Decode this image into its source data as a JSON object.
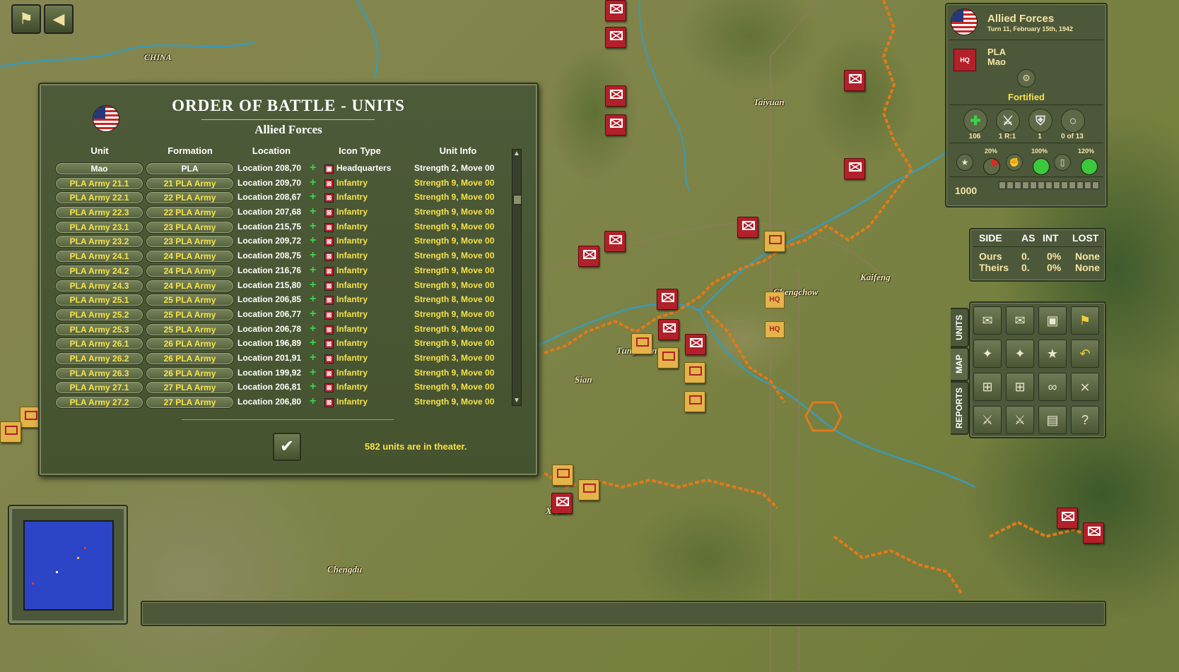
{
  "map": {
    "labels": [
      "CHINA",
      "Taiyuan",
      "Chengchow",
      "Kaifeng",
      "Tungkwan",
      "Sian",
      "Xi'an",
      "Chengdu"
    ]
  },
  "toolbar": {
    "flag_icon": "flag-icon",
    "back_icon": "back-arrow-icon"
  },
  "oob": {
    "title": "ORDER OF BATTLE - UNITS",
    "subtitle": "Allied Forces",
    "columns": [
      "Unit",
      "Formation",
      "Location",
      "Icon Type",
      "Unit Info"
    ],
    "rows": [
      {
        "unit": "Mao",
        "formation": "PLA",
        "location": "Location 208,70",
        "type": "Headquarters",
        "info": "Strength 2, Move 00"
      },
      {
        "unit": "PLA Army 21.1",
        "formation": "21 PLA Army",
        "location": "Location 209,70",
        "type": "Infantry",
        "info": "Strength 9, Move 00"
      },
      {
        "unit": "PLA Army 22.1",
        "formation": "22 PLA Army",
        "location": "Location 208,67",
        "type": "Infantry",
        "info": "Strength 9, Move 00"
      },
      {
        "unit": "PLA Army 22.3",
        "formation": "22 PLA Army",
        "location": "Location 207,68",
        "type": "Infantry",
        "info": "Strength 9, Move 00"
      },
      {
        "unit": "PLA Army 23.1",
        "formation": "23 PLA Army",
        "location": "Location 215,75",
        "type": "Infantry",
        "info": "Strength 9, Move 00"
      },
      {
        "unit": "PLA Army 23.2",
        "formation": "23 PLA Army",
        "location": "Location 209,72",
        "type": "Infantry",
        "info": "Strength 9, Move 00"
      },
      {
        "unit": "PLA Army 24.1",
        "formation": "24 PLA Army",
        "location": "Location 208,75",
        "type": "Infantry",
        "info": "Strength 9, Move 00"
      },
      {
        "unit": "PLA Army 24.2",
        "formation": "24 PLA Army",
        "location": "Location 216,76",
        "type": "Infantry",
        "info": "Strength 9, Move 00"
      },
      {
        "unit": "PLA Army 24.3",
        "formation": "24 PLA Army",
        "location": "Location 215,80",
        "type": "Infantry",
        "info": "Strength 9, Move 00"
      },
      {
        "unit": "PLA Army 25.1",
        "formation": "25 PLA Army",
        "location": "Location 206,85",
        "type": "Infantry",
        "info": "Strength 8, Move 00"
      },
      {
        "unit": "PLA Army 25.2",
        "formation": "25 PLA Army",
        "location": "Location 206,77",
        "type": "Infantry",
        "info": "Strength 9, Move 00"
      },
      {
        "unit": "PLA Army 25.3",
        "formation": "25 PLA Army",
        "location": "Location 206,78",
        "type": "Infantry",
        "info": "Strength 9, Move 00"
      },
      {
        "unit": "PLA Army 26.1",
        "formation": "26 PLA Army",
        "location": "Location 196,89",
        "type": "Infantry",
        "info": "Strength 9, Move 00"
      },
      {
        "unit": "PLA Army 26.2",
        "formation": "26 PLA Army",
        "location": "Location 201,91",
        "type": "Infantry",
        "info": "Strength 3, Move 00"
      },
      {
        "unit": "PLA Army 26.3",
        "formation": "26 PLA Army",
        "location": "Location 199,92",
        "type": "Infantry",
        "info": "Strength 9, Move 00"
      },
      {
        "unit": "PLA Army 27.1",
        "formation": "27 PLA Army",
        "location": "Location 206,81",
        "type": "Infantry",
        "info": "Strength 9, Move 00"
      },
      {
        "unit": "PLA Army 27.2",
        "formation": "27 PLA Army",
        "location": "Location 206,80",
        "type": "Infantry",
        "info": "Strength 9, Move 00"
      }
    ],
    "count_text": "582 units are in theater.",
    "ok_icon": "checkmark-icon"
  },
  "info_panel": {
    "side": "Allied Forces",
    "turn": "Turn 11, February 15th, 1942",
    "unit_formation": "PLA",
    "unit_name": "Mao",
    "status": "Fortified",
    "stats": [
      "106",
      "1 R:1",
      "1",
      "0 of 13"
    ],
    "gauges": [
      {
        "percent": "20%",
        "level": 0.2,
        "color": "#d03020"
      },
      {
        "percent": "100%",
        "level": 1.0,
        "color": "#3cc83c"
      },
      {
        "percent": "120%",
        "level": 1.0,
        "color": "#3cc83c"
      }
    ],
    "points": "1000"
  },
  "combat": {
    "headers": [
      "SIDE",
      "AS",
      "INT",
      "LOST"
    ],
    "rows": [
      {
        "side": "Ours",
        "as": "0.",
        "int": "0%",
        "lost": "None"
      },
      {
        "side": "Theirs",
        "as": "0.",
        "int": "0%",
        "lost": "None"
      }
    ]
  },
  "tabs": [
    "UNITS",
    "MAP",
    "REPORTS"
  ],
  "colors": {
    "panel": "#4c5839",
    "text_yellow": "#f6e24a",
    "unit_red": "#b2202a",
    "sea": "#2c44c6"
  }
}
